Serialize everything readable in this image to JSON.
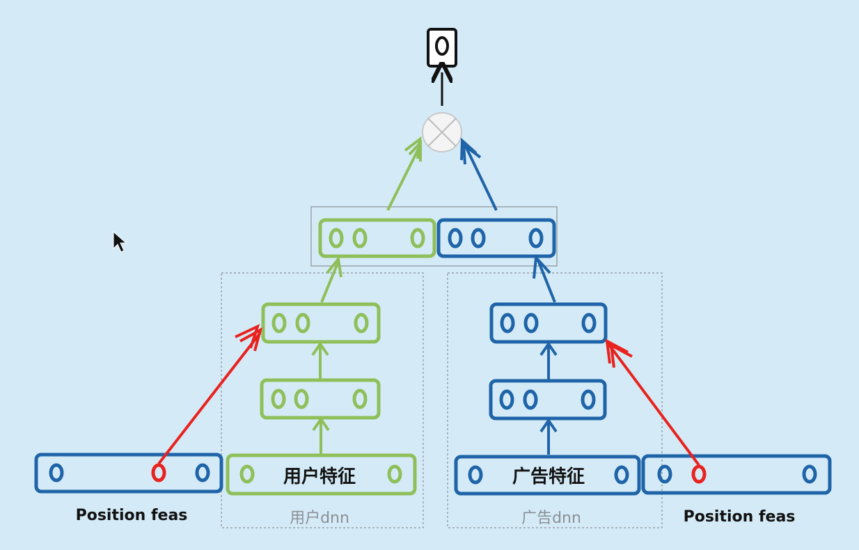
{
  "left_position_label": "Position feas",
  "right_position_label": "Position feas",
  "user_feature_label": "用户特征",
  "ad_feature_label": "广告特征",
  "user_dnn_label": "用户dnn",
  "ad_dnn_label": "广告dnn",
  "colors": {
    "background": "#d4ebf7",
    "green": "#8fbf5a",
    "blue": "#1f64a8",
    "red": "#e8231f",
    "black": "#111111",
    "dashed_border": "#8a8f96"
  },
  "icons": [
    "output-node-icon",
    "product-op-icon",
    "cursor-icon"
  ]
}
